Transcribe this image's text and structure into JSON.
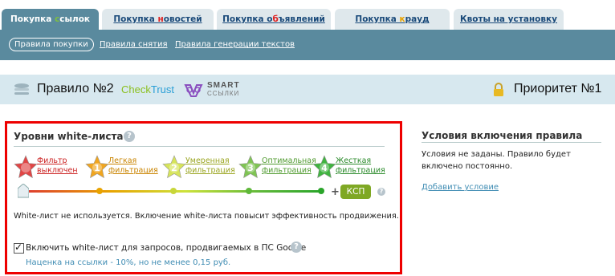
{
  "tabs": [
    {
      "label_pre": "Покупка ",
      "label_hl": "с",
      "label_post": "сылок",
      "hl": "g"
    },
    {
      "label_pre": "Покупка ",
      "label_hl": "н",
      "label_post": "овостей",
      "hl": "r"
    },
    {
      "label_pre": "Покупка о",
      "label_hl": "б",
      "label_post": "ъявлений",
      "hl": "r"
    },
    {
      "label_pre": "Покупка ",
      "label_hl": "к",
      "label_post": "рауд",
      "hl": "y"
    },
    {
      "label_pre": "Квоты на установку",
      "label_hl": "",
      "label_post": "",
      "hl": ""
    }
  ],
  "subnav": [
    "Правила покупки",
    "Правила снятия",
    "Правила генерации текстов"
  ],
  "rule": {
    "title": "Правило №2",
    "checktrust_a": "Check",
    "checktrust_b": "Trust",
    "smart": "SMART",
    "smart_sub": "ССЫЛКИ",
    "priority": "Приоритет №1"
  },
  "whitelist": {
    "title": "Уровни white-листа",
    "levels": [
      {
        "num": "",
        "line1": "Фильтр",
        "line2": "выключен",
        "color": "#e04545",
        "text_color": "#cc2222"
      },
      {
        "num": "1",
        "line1": "Легкая",
        "line2": "фильтрация",
        "color": "#f0a51f",
        "text_color": "#c98400"
      },
      {
        "num": "2",
        "line1": "Умеренная",
        "line2": "фильтрация",
        "color": "#d6e45a",
        "text_color": "#9aa520"
      },
      {
        "num": "3",
        "line1": "Оптимальная",
        "line2": "фильтрация",
        "color": "#7fc453",
        "text_color": "#4f9a2e"
      },
      {
        "num": "4",
        "line1": "Жесткая",
        "line2": "фильтрация",
        "color": "#3fb33f",
        "text_color": "#2a8a2a"
      }
    ],
    "ksp": "КСП",
    "plus": "+",
    "info": "White-лист не используется. Включение white-листа повысит эффективность продвижения.",
    "checkbox_label": "Включить white-лист для запросов, продвигаемых в ПС Google",
    "checked": true,
    "markup": "Наценка на ссылки - 10%, но не менее 0,15 руб."
  },
  "conditions": {
    "title": "Условия включения правила",
    "text": "Условия не заданы. Правило будет включено постоянно.",
    "add_link": "Добавить условие"
  },
  "colors": {
    "accent": "#5a8a9e",
    "highlight_border": "#e00000",
    "link": "#3f8cb3"
  }
}
